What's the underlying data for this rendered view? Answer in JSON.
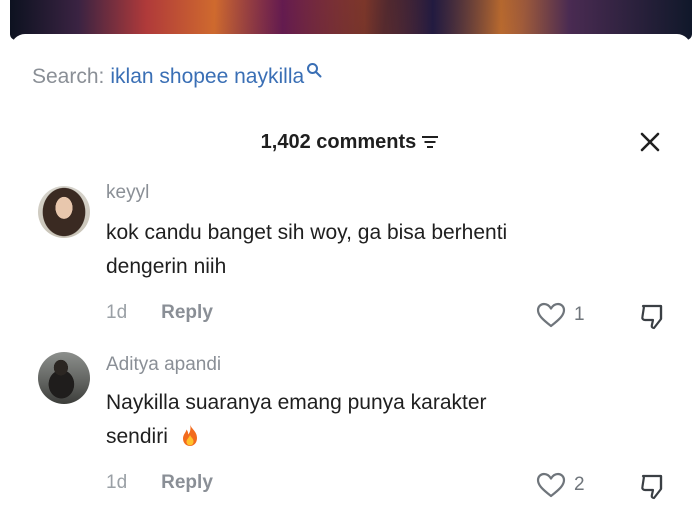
{
  "search": {
    "prefix": "Search:",
    "term": "iklan shopee naykilla"
  },
  "comments_header": {
    "count_label": "1,402 comments"
  },
  "comments": [
    {
      "username": "keyyl",
      "text_lines": [
        "kok candu banget sih woy, ga bisa berhenti",
        "dengerin niih"
      ],
      "time": "1d",
      "reply_label": "Reply",
      "likes": "1"
    },
    {
      "username": "Aditya apandi",
      "text_lines": [
        "Naykilla suaranya emang punya karakter",
        "sendiri"
      ],
      "time": "1d",
      "reply_label": "Reply",
      "likes": "2",
      "emoji": "fire-icon"
    }
  ],
  "colors": {
    "link_blue": "#3a6fb5",
    "muted_gray": "#8a8f96",
    "text_dark": "#1f1f1f"
  }
}
